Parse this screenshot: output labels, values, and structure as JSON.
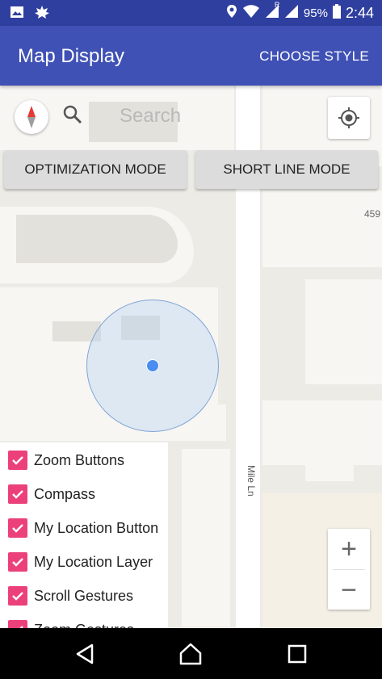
{
  "status_bar": {
    "battery_percent": "95%",
    "time": "2:44",
    "roaming_indicator": "R",
    "icons": [
      "image-icon",
      "leaf-icon",
      "location-pin-icon",
      "wifi-icon",
      "signal-icon",
      "signal-icon",
      "battery-icon"
    ]
  },
  "app_bar": {
    "title": "Map Display",
    "action": "CHOOSE STYLE"
  },
  "search": {
    "placeholder": "Search"
  },
  "mode_buttons": {
    "optimization": "OPTIMIZATION MODE",
    "short_line": "SHORT LINE MODE"
  },
  "map": {
    "street_label": "Mile Ln",
    "address_label": "459"
  },
  "zoom": {
    "plus": "+",
    "minus": "−"
  },
  "options": [
    {
      "label": "Zoom Buttons",
      "checked": true
    },
    {
      "label": "Compass",
      "checked": true
    },
    {
      "label": "My Location Button",
      "checked": true
    },
    {
      "label": "My Location Layer",
      "checked": true
    },
    {
      "label": "Scroll Gestures",
      "checked": true
    },
    {
      "label": "Zoom Gestures",
      "checked": true
    }
  ],
  "colors": {
    "status_bar": "#2f3f9f",
    "app_bar": "#3f51b5",
    "checkbox": "#ec407a",
    "location_dot": "#4a8cf0"
  }
}
